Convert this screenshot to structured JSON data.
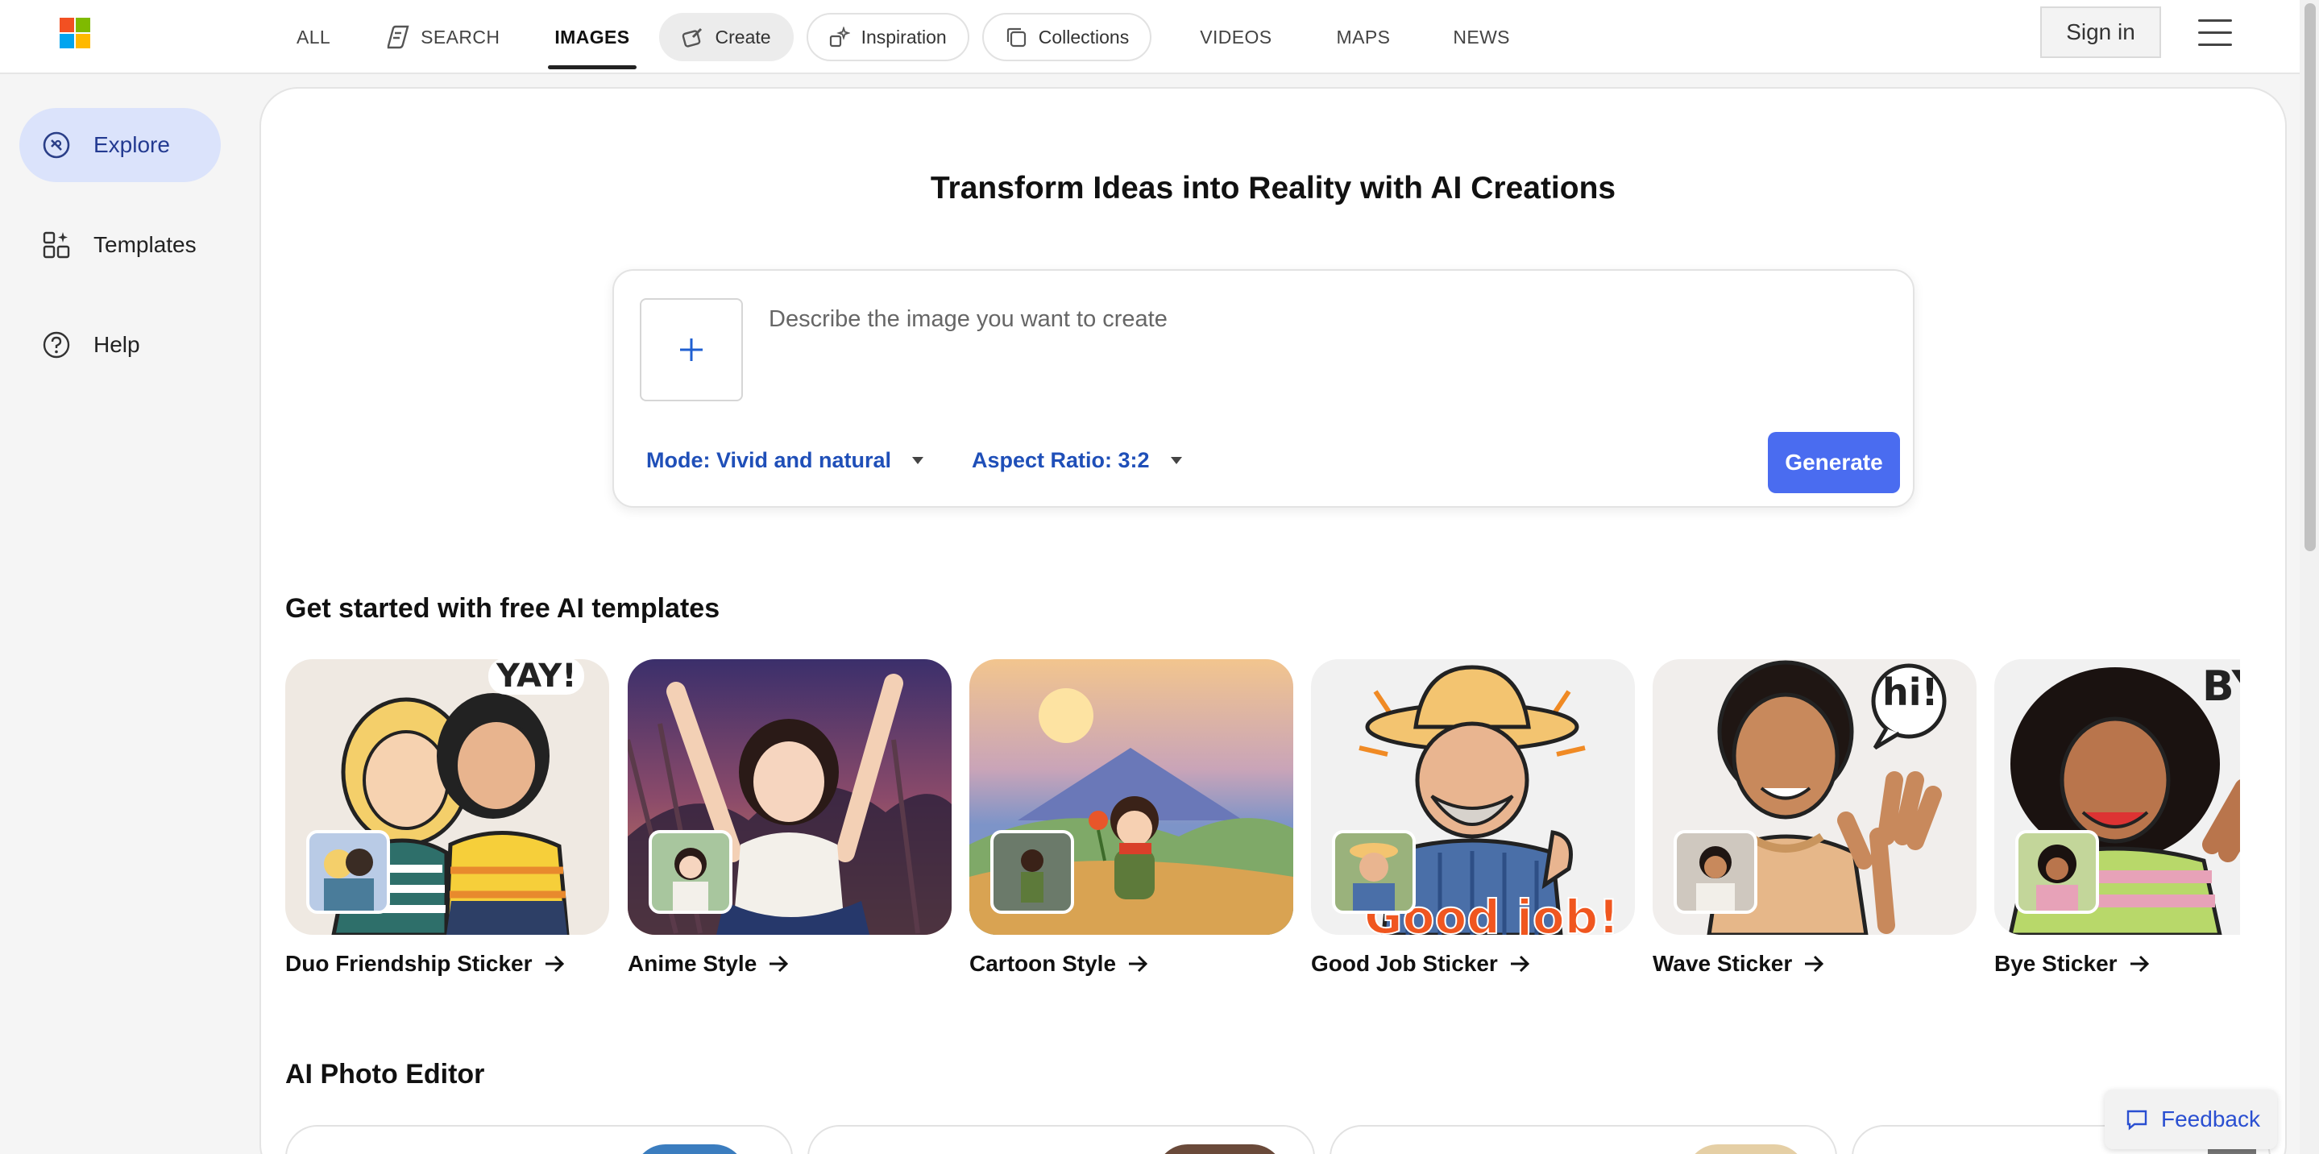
{
  "nav": {
    "all": "ALL",
    "search": "SEARCH",
    "images": "IMAGES",
    "create": "Create",
    "inspiration": "Inspiration",
    "collections": "Collections",
    "videos": "VIDEOS",
    "maps": "MAPS",
    "news": "NEWS",
    "sign_in": "Sign in"
  },
  "sidebar": {
    "items": [
      {
        "label": "Explore",
        "icon": "compass-icon",
        "active": true
      },
      {
        "label": "Templates",
        "icon": "templates-icon",
        "active": false
      },
      {
        "label": "Help",
        "icon": "help-circle-icon",
        "active": false
      }
    ]
  },
  "hero": {
    "title": "Transform Ideas into Reality with AI Creations",
    "prompt_placeholder": "Describe the image you want to create",
    "mode": "Mode: Vivid and natural",
    "aspect": "Aspect Ratio: 3:2",
    "generate": "Generate"
  },
  "templates_section": {
    "title": "Get started with free AI templates",
    "cards": [
      {
        "label": "Duo Friendship Sticker",
        "overlay": "YAY!"
      },
      {
        "label": "Anime Style",
        "overlay": ""
      },
      {
        "label": "Cartoon Style",
        "overlay": ""
      },
      {
        "label": "Good Job Sticker",
        "overlay": "Good job!"
      },
      {
        "label": "Wave Sticker",
        "overlay": "hi!"
      },
      {
        "label": "Bye Sticker",
        "overlay": "BY"
      }
    ]
  },
  "editor_section": {
    "title": "AI Photo Editor"
  },
  "feedback": "Feedback",
  "colors": {
    "accent": "#4a6cf0",
    "link": "#1f4fb8",
    "sidebar_active": "#dbe3fb"
  }
}
